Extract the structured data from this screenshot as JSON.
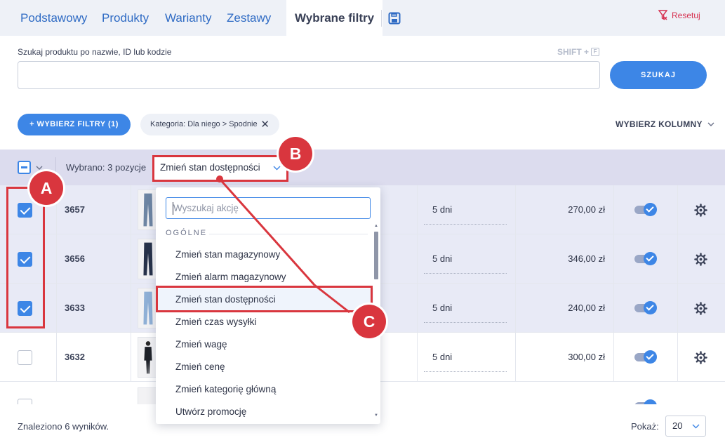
{
  "tabs": [
    {
      "label": "Podstawowy"
    },
    {
      "label": "Produkty"
    },
    {
      "label": "Warianty"
    },
    {
      "label": "Zestawy"
    },
    {
      "label": "Wybrane filtry",
      "active": true
    }
  ],
  "reset_label": "Resetuj",
  "search": {
    "label": "Szukaj produktu po nazwie, ID lub kodzie",
    "shortcut": "SHIFT +",
    "shortcut_key": "F",
    "button": "SZUKAJ"
  },
  "filters": {
    "button": "+ WYBIERZ FILTRY (1)",
    "chip": "Kategoria: Dla niego > Spodnie",
    "columns": "WYBIERZ KOLUMNY"
  },
  "bulk": {
    "selected_text": "Wybrano: 3 pozycje",
    "action_value": "Zmień stan dostępności"
  },
  "rows": [
    {
      "id": "3657",
      "days": "5 dni",
      "price": "270,00 zł",
      "selected": true
    },
    {
      "id": "3656",
      "days": "5 dni",
      "price": "346,00 zł",
      "selected": true
    },
    {
      "id": "3633",
      "days": "5 dni",
      "price": "240,00 zł",
      "selected": true
    },
    {
      "id": "3632",
      "days": "5 dni",
      "price": "300,00 zł",
      "selected": false
    }
  ],
  "dropdown": {
    "search_placeholder": "Wyszukaj akcję",
    "group": "OGÓLNE",
    "items": [
      "Zmień stan magazynowy",
      "Zmień alarm magazynowy",
      "Zmień stan dostępności",
      "Zmień czas wysyłki",
      "Zmień wagę",
      "Zmień cenę",
      "Zmień kategorię główną",
      "Utwórz promocję"
    ],
    "highlighted_index": 2
  },
  "footer": {
    "results": "Znaleziono 6 wyników.",
    "show_label": "Pokaż:",
    "page_size": "20"
  },
  "annotations": {
    "a": "A",
    "b": "B",
    "c": "C"
  },
  "colors": {
    "accent": "#3d86e6",
    "annotation": "#d9363e",
    "selected_row": "#e8eaf6"
  }
}
